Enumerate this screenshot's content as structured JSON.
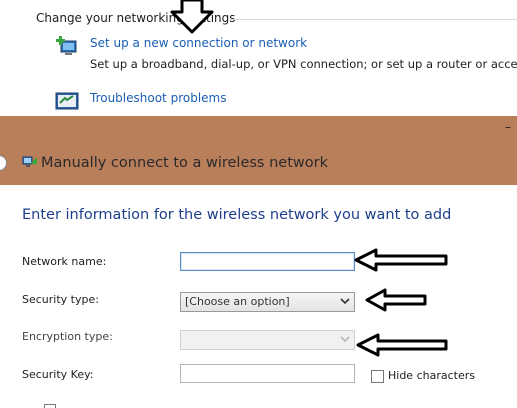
{
  "background_panel": {
    "heading": "Change your networking settings",
    "items": [
      {
        "label": "Set up a new connection or network",
        "description": "Set up a broadband, dial-up, or VPN connection; or set up a router or access poin"
      },
      {
        "label": "Troubleshoot problems"
      }
    ]
  },
  "dialog": {
    "title": "Manually connect to a wireless network",
    "close_glyph": "–",
    "heading": "Enter information for the wireless network you want to add",
    "fields": {
      "network_name": {
        "label": "Network name:",
        "value": ""
      },
      "security_type": {
        "label": "Security type:",
        "selected": "[Choose an option]"
      },
      "encryption_type": {
        "label": "Encryption type:",
        "selected": ""
      },
      "security_key": {
        "label": "Security Key:",
        "value": ""
      }
    },
    "hide_characters": {
      "label": "Hide characters",
      "checked": false
    }
  },
  "colors": {
    "titlebar": "#b97e5a",
    "heading": "#1f3f8c",
    "link": "#1a5fb4"
  }
}
